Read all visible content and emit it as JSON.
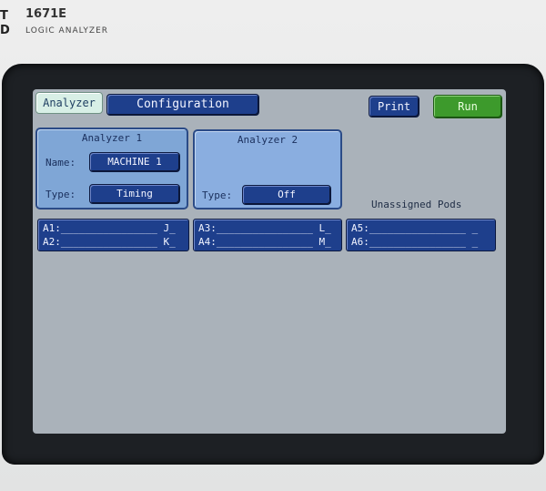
{
  "device": {
    "brand_mark": "T\nD",
    "model": "1671E",
    "subtitle": "LOGIC ANALYZER"
  },
  "toolbar": {
    "analyzer_tab": "Analyzer",
    "configuration_tab": "Configuration",
    "print_label": "Print",
    "run_label": "Run"
  },
  "analyzer1": {
    "title": "Analyzer 1",
    "name_label": "Name:",
    "name_value": "MACHINE 1",
    "type_label": "Type:",
    "type_value": "Timing"
  },
  "analyzer2": {
    "title": "Analyzer 2",
    "type_label": "Type:",
    "type_value": "Off"
  },
  "unassigned_label": "Unassigned Pods",
  "pods": {
    "group1": [
      "A1:________________ J_",
      "A2:________________ K_"
    ],
    "group2": [
      "A3:________________ L_",
      "A4:________________ M_"
    ],
    "group3": [
      "A5:________________ _",
      "A6:________________ _"
    ]
  },
  "colors": {
    "accent_blue": "#1e3f8c",
    "panel_blue": "#7fa6d6",
    "run_green": "#3d9a2c",
    "screen_gray": "#aab2ba"
  }
}
